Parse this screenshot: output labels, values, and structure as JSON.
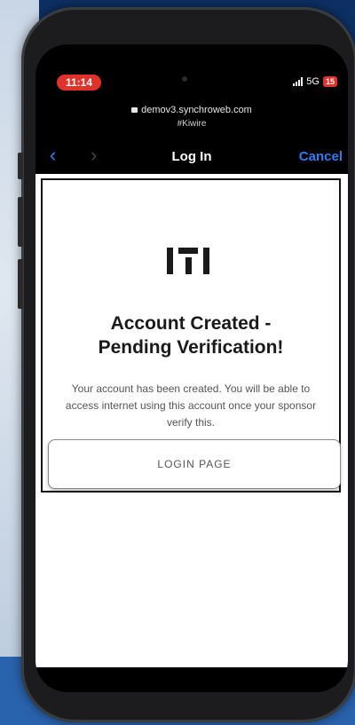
{
  "status_bar": {
    "time": "11:14",
    "network": "5G",
    "battery": "15"
  },
  "browser": {
    "url": "demov3.synchroweb.com",
    "url_sub": "#Kiwire",
    "nav_title": "Log In",
    "cancel_label": "Cancel",
    "back_icon": "chevron-left-icon",
    "forward_icon": "chevron-right-icon"
  },
  "page": {
    "headline_line1": "Account Created -",
    "headline_line2": "Pending Verification!",
    "message": "Your account has been created. You will be able to access internet using this account once your sponsor verify this.",
    "login_button": "LOGIN PAGE"
  },
  "colors": {
    "time_pill": "#e0322a",
    "link_blue": "#2e7cf6",
    "background_blue": "#1c4a8a"
  }
}
